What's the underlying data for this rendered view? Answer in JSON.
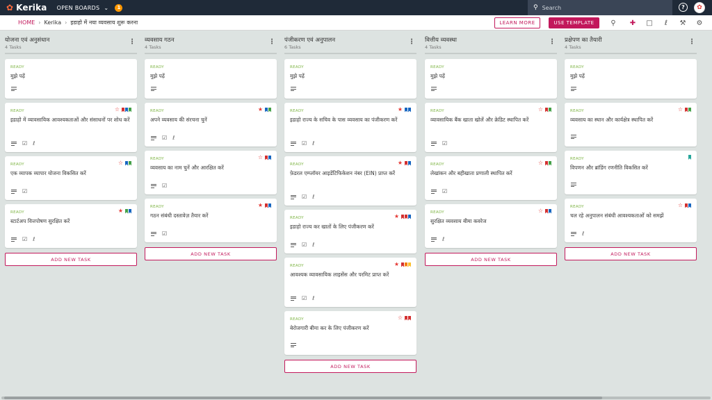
{
  "app": {
    "logo": "Kerika",
    "open_boards": "OPEN BOARDS",
    "notification_count": "1",
    "search_placeholder": "Search"
  },
  "breadcrumb": {
    "home": "HOME",
    "org": "Kerika",
    "board": "इडाहो में नया व्यवसाय शुरू करना"
  },
  "actions": {
    "learn_more": "LEARN MORE",
    "use_template": "USE TEMPLATE"
  },
  "colors": {
    "accent": "#c2185b",
    "ready": "#7cb342",
    "topbar": "#1f2a38",
    "board_bg": "#dde3e1"
  },
  "columns": [
    {
      "title": "योजना एवं अनुसंधान",
      "count": "4 Tasks",
      "add_label": "ADD NEW TASK",
      "cards": [
        {
          "status": "READY",
          "title": "मुझे पढ़ें",
          "icons": [
            "description-icon"
          ],
          "flags": []
        },
        {
          "status": "READY",
          "title": "इडाहो में व्यावसायिक आवश्यकताओं और संसाधनों पर शोध करें",
          "icons": [
            "description-icon",
            "checklist-icon",
            "attachment-icon"
          ],
          "flags": [
            "star-outline",
            "red",
            "blue",
            "green"
          ]
        },
        {
          "status": "READY",
          "title": "एक व्यापक व्यापार योजना विकसित करें",
          "icons": [
            "description-icon",
            "checklist-icon"
          ],
          "flags": [
            "star-outline",
            "blue",
            "green"
          ]
        },
        {
          "status": "READY",
          "title": "स्टार्टअप वित्तपोषण सुरक्षित करें",
          "icons": [
            "description-icon",
            "checklist-icon",
            "attachment-icon"
          ],
          "flags": [
            "star-filled",
            "green",
            "blue"
          ]
        }
      ]
    },
    {
      "title": "व्यवसाय गठन",
      "count": "4 Tasks",
      "add_label": "ADD NEW TASK",
      "cards": [
        {
          "status": "READY",
          "title": "मुझे पढ़ें",
          "icons": [
            "description-icon"
          ],
          "flags": []
        },
        {
          "status": "READY",
          "title": "अपने व्यवसाय की संरचना चुनें",
          "icons": [
            "description-icon",
            "checklist-icon",
            "attachment-icon"
          ],
          "flags": [
            "star-filled",
            "blue",
            "green"
          ]
        },
        {
          "status": "READY",
          "title": "व्यवसाय का नाम चुनें और आरक्षित करें",
          "icons": [
            "description-icon",
            "checklist-icon"
          ],
          "flags": [
            "star-outline",
            "red",
            "blue"
          ]
        },
        {
          "status": "READY",
          "title": "गठन संबंधी दस्तावेज़ तैयार करें",
          "icons": [
            "description-icon",
            "checklist-icon"
          ],
          "flags": [
            "star-filled",
            "red",
            "blue"
          ]
        }
      ]
    },
    {
      "title": "पंजीकरण एवं अनुपालन",
      "count": "6 Tasks",
      "add_label": "ADD NEW TASK",
      "cards": [
        {
          "status": "READY",
          "title": "मुझे पढ़ें",
          "icons": [
            "description-icon"
          ],
          "flags": []
        },
        {
          "status": "READY",
          "title": "इडाहो राज्य के सचिव के पास व्यवसाय का पंजीकरण करें",
          "icons": [
            "description-icon",
            "checklist-icon",
            "attachment-icon"
          ],
          "flags": [
            "star-filled",
            "blue",
            "blue"
          ]
        },
        {
          "status": "READY",
          "title": "फ़ेडरल एम्प्लॉयर आइडेंटिफिकेशन नंबर (EIN) प्राप्त करें",
          "icons": [
            "description-icon",
            "checklist-icon",
            "attachment-icon"
          ],
          "flags": [
            "star-filled",
            "red",
            "blue"
          ]
        },
        {
          "status": "READY",
          "title": "इडाहो राज्य कर खातों के लिए पंजीकरण करें",
          "icons": [
            "description-icon",
            "checklist-icon",
            "attachment-icon"
          ],
          "flags": [
            "star-filled",
            "red",
            "red",
            "blue"
          ]
        },
        {
          "status": "READY",
          "title": "आवश्यक व्यावसायिक लाइसेंस और परमिट प्राप्त करें",
          "icons": [
            "description-icon",
            "checklist-icon",
            "attachment-icon"
          ],
          "flags": [
            "star-filled",
            "red",
            "orange",
            "yellow"
          ]
        },
        {
          "status": "READY",
          "title": "बेरोजगारी बीमा कर के लिए पंजीकरण करें",
          "icons": [
            "description-icon"
          ],
          "flags": [
            "star-outline",
            "red",
            "red"
          ]
        }
      ]
    },
    {
      "title": "वित्तीय व्यवस्था",
      "count": "4 Tasks",
      "add_label": "ADD NEW TASK",
      "cards": [
        {
          "status": "READY",
          "title": "मुझे पढ़ें",
          "icons": [
            "description-icon"
          ],
          "flags": []
        },
        {
          "status": "READY",
          "title": "व्यावसायिक बैंक खाता खोलें और क्रेडिट स्थापित करें",
          "icons": [
            "description-icon",
            "checklist-icon"
          ],
          "flags": [
            "star-outline",
            "red",
            "green"
          ]
        },
        {
          "status": "READY",
          "title": "लेखांकन और बहीखाता प्रणाली स्थापित करें",
          "icons": [
            "description-icon",
            "checklist-icon"
          ],
          "flags": [
            "star-outline",
            "red",
            "green"
          ]
        },
        {
          "status": "READY",
          "title": "सुरक्षित व्यवसाय बीमा कवरेज",
          "icons": [
            "description-icon",
            "attachment-icon"
          ],
          "flags": [
            "star-outline",
            "red",
            "blue"
          ]
        }
      ]
    },
    {
      "title": "प्रक्षेपण का तैयारी",
      "count": "4 Tasks",
      "add_label": "ADD NEW TASK",
      "cards": [
        {
          "status": "READY",
          "title": "मुझे पढ़ें",
          "icons": [
            "description-icon"
          ],
          "flags": []
        },
        {
          "status": "READY",
          "title": "व्यवसाय का स्थान और कार्यक्षेत्र स्थापित करें",
          "icons": [
            "description-icon"
          ],
          "flags": [
            "star-outline",
            "red",
            "green"
          ]
        },
        {
          "status": "READY",
          "title": "विपणन और ब्रांडिंग रणनीति विकसित करें",
          "icons": [
            "description-icon"
          ],
          "flags": [
            "teal"
          ]
        },
        {
          "status": "READY",
          "title": "चल रहे अनुपालन संबंधी आवश्यकताओं को समझें",
          "icons": [
            "description-icon",
            "attachment-icon"
          ],
          "flags": [
            "star-outline",
            "red",
            "blue"
          ]
        }
      ]
    }
  ]
}
